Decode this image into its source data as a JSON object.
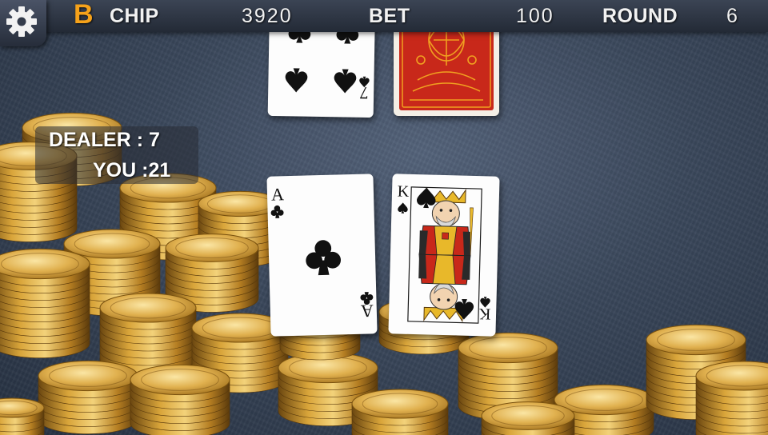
{
  "hud": {
    "logo": "B",
    "chip_label": "CHIP",
    "chip_value": "3920",
    "bet_label": "BET",
    "bet_value": "100",
    "round_label": "ROUND",
    "round_value": "6"
  },
  "scores": {
    "dealer_label": "DEALER : ",
    "dealer_value": "7",
    "you_label": "YOU :",
    "you_value": "21"
  },
  "dealer_cards": [
    {
      "rank": "7",
      "suit": "spades",
      "face_up": true
    },
    {
      "face_up": false
    }
  ],
  "player_cards": [
    {
      "rank": "A",
      "suit": "clubs",
      "face_up": true
    },
    {
      "rank": "K",
      "suit": "spades",
      "face_up": true
    }
  ],
  "icons": {
    "settings": "gear-icon"
  },
  "colors": {
    "accent": "#f6a21a",
    "card_back": "#c8281a",
    "table": "#3a475b",
    "coin": "#d9a53a"
  }
}
